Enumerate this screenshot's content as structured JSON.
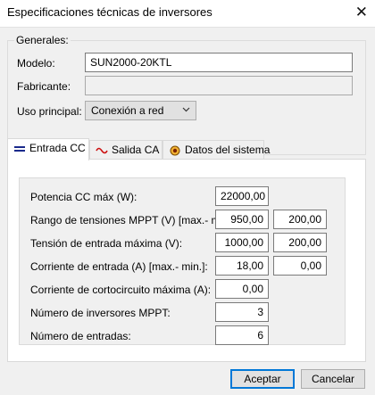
{
  "window": {
    "title": "Especificaciones técnicas de inversores",
    "close_glyph": "✕"
  },
  "generales": {
    "legend": "Generales:",
    "modelo_label": "Modelo:",
    "modelo_value": "SUN2000-20KTL",
    "fabricante_label": "Fabricante:",
    "fabricante_value": "",
    "uso_label": "Uso principal:",
    "uso_value": "Conexión a red"
  },
  "tabs": [
    {
      "label": "Entrada CC",
      "icon": "dc-icon",
      "active": true
    },
    {
      "label": "Salida CA",
      "icon": "ac-wave-icon",
      "active": false
    },
    {
      "label": "Datos del sistema",
      "icon": "system-data-icon",
      "active": false
    }
  ],
  "entrada_cc": {
    "rows": [
      {
        "label": "Potencia CC máx (W):",
        "v1": "22000,00"
      },
      {
        "label": "Rango de tensiones MPPT (V) [max.- min.",
        "v1": "950,00",
        "v2": "200,00"
      },
      {
        "label": "Tensión de entrada máxima (V):",
        "v1": "1000,00",
        "v2": "200,00"
      },
      {
        "label": "Corriente de entrada (A) [max.- min.]:",
        "v1": "18,00",
        "v2": "0,00"
      },
      {
        "label": "Corriente de cortocircuito máxima (A):",
        "v1": "0,00"
      },
      {
        "label": "Número de inversores MPPT:",
        "v1": "3"
      },
      {
        "label": "Número de entradas:",
        "v1": "6"
      }
    ]
  },
  "buttons": {
    "accept": "Aceptar",
    "cancel": "Cancelar"
  },
  "colors": {
    "accent": "#0078d7",
    "dc_icon": "#1a2a8c",
    "ac_icon": "#cc1111",
    "system_icon": "#c47a00"
  }
}
